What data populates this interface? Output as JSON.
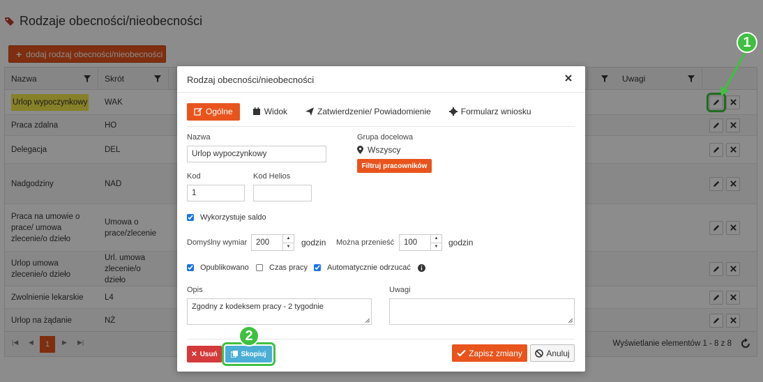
{
  "page": {
    "title": "Rodzaje obecności/nieobecności",
    "add_button": "dodaj rodzaj obecności/nieobecności"
  },
  "grid": {
    "columns": [
      "Nazwa",
      "Skrót",
      "Uwagi"
    ],
    "rows": [
      {
        "name": "Urlop wypoczynkowy",
        "short": "WAK"
      },
      {
        "name": "Praca zdalna",
        "short": "HO"
      },
      {
        "name": "Delegacja",
        "short": "DEL"
      },
      {
        "name": "Nadgodziny",
        "short": "NAD"
      },
      {
        "name": "Praca na umowie o prace/ umowa zlecenie/o dzieło",
        "short": "Umowa o prace/zlecenie"
      },
      {
        "name": "Urlop umowa zlecenie/o dzieło",
        "short": "Url. umowa zlecenie/o dzieło"
      },
      {
        "name": "Zwolnienie lekarskie",
        "short": "L4"
      },
      {
        "name": "Urlop na żądanie",
        "short": "NŻ"
      }
    ],
    "pager": {
      "current_page": "1",
      "info": "Wyświetlanie elementów 1 - 8 z 8"
    }
  },
  "modal": {
    "title": "Rodzaj obecności/nieobecności",
    "tabs": [
      "Ogólne",
      "Widok",
      "Zatwierdzenie/ Powiadomienie",
      "Formularz wniosku"
    ],
    "name_label": "Nazwa",
    "name_value": "Urlop wypoczynkowy",
    "code_label": "Kod",
    "code_value": "1",
    "helios_label": "Kod Helios",
    "helios_value": "",
    "target_group_label": "Grupa docelowa",
    "target_group_value": "Wszyscy",
    "filter_button": "Filtruj pracowników",
    "uses_balance_label": "Wykorzystuje saldo",
    "default_label": "Domyślny wymiar",
    "default_value": "200",
    "default_unit": "godzin",
    "transfer_label": "Można przenieść",
    "transfer_value": "100",
    "transfer_unit": "godzin",
    "published_label": "Opublikowano",
    "work_time_label": "Czas pracy",
    "auto_reject_label": "Automatycznie odrzucać",
    "desc_label": "Opis",
    "desc_value": "Zgodny z kodeksem pracy - 2 tygodnie",
    "notes_label": "Uwagi",
    "notes_value": "",
    "delete_button": "Usuń",
    "copy_button": "Skopiuj",
    "save_button": "Zapisz zmiany",
    "cancel_button": "Anuluj"
  },
  "markers": [
    "1",
    "2"
  ],
  "colors": {
    "accent": "#e8541c",
    "highlight": "#3fc13f",
    "delete": "#d43a3a",
    "copy": "#4aaed6"
  }
}
